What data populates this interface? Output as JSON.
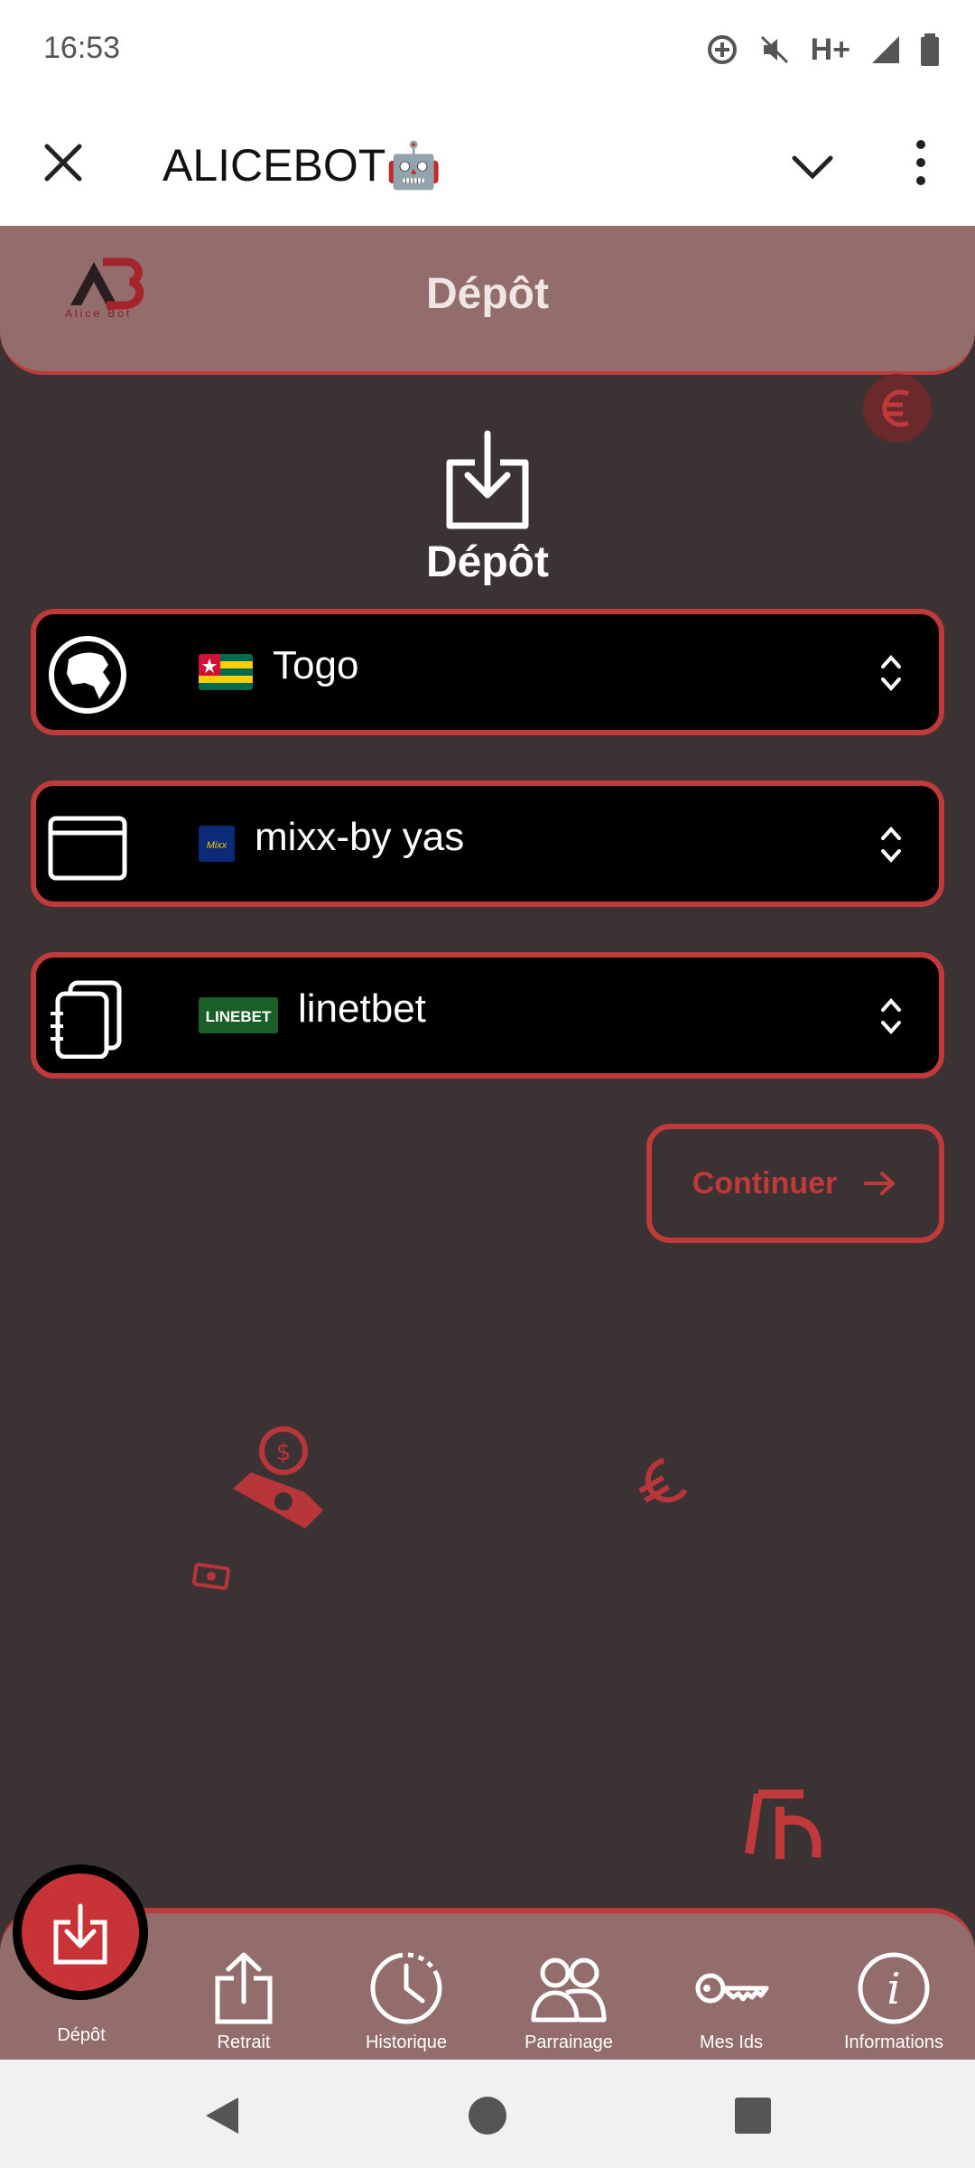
{
  "status_bar": {
    "time": "16:53",
    "network": "H+"
  },
  "app_bar": {
    "title": "ALICEBOT🤖"
  },
  "header": {
    "logo_text": "Alice Bot",
    "title": "Dépôt"
  },
  "main": {
    "heading": "Dépôt",
    "selectors": [
      {
        "icon": "globe-africa-icon",
        "value": "Togo",
        "flag": "togo-flag"
      },
      {
        "icon": "wallet-icon",
        "value": "mixx-by yas",
        "flag": "mixx-logo"
      },
      {
        "icon": "stack-icon",
        "value": "linetbet",
        "flag": "linebet-logo"
      }
    ],
    "continue_label": "Continuer"
  },
  "bottom_nav": [
    {
      "label": "Dépôt",
      "icon": "download-icon",
      "active": true
    },
    {
      "label": "Retrait",
      "icon": "upload-icon"
    },
    {
      "label": "Historique",
      "icon": "clock-icon"
    },
    {
      "label": "Parrainage",
      "icon": "users-icon"
    },
    {
      "label": "Mes Ids",
      "icon": "key-icon"
    },
    {
      "label": "Informations",
      "icon": "info-icon"
    }
  ],
  "colors": {
    "accent": "#c0393b",
    "header_bg": "#936c6c",
    "page_bg": "#3a3233"
  }
}
